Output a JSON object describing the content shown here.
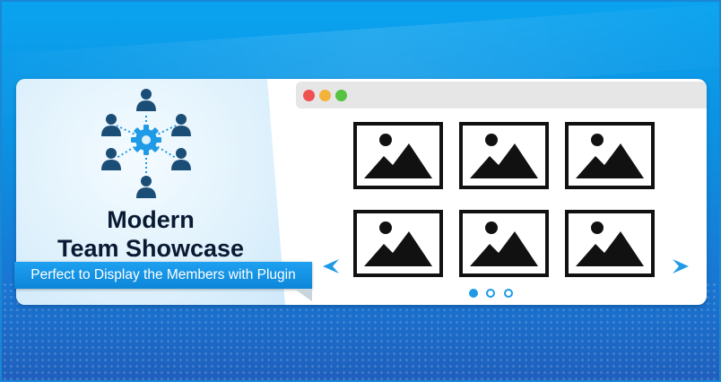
{
  "banner": {
    "title_line1": "Modern",
    "title_line2": "Team Showcase",
    "tagline": "Perfect to Display the Members with Plugin"
  },
  "browser": {
    "window_controls": [
      "close",
      "minimize",
      "maximize"
    ]
  },
  "gallery": {
    "tiles": [
      "image-placeholder",
      "image-placeholder",
      "image-placeholder",
      "image-placeholder",
      "image-placeholder",
      "image-placeholder"
    ],
    "pagination": {
      "pages": 3,
      "active": 1
    }
  },
  "colors": {
    "accent": "#0d86d8",
    "background_top": "#0aa3ef",
    "background_bottom": "#1f5fbd",
    "title_text": "#0a1a33",
    "hub_blue": "#1e9ae6",
    "person_icon": "#1b4e77",
    "traffic_red": "#f0504f",
    "traffic_yellow": "#f3b33b",
    "traffic_green": "#55c242"
  },
  "icons": {
    "hub": "team-network-icon",
    "person": "person-icon",
    "tile": "image-placeholder-icon",
    "prev": "arrow-left-icon",
    "next": "arrow-right-icon"
  }
}
